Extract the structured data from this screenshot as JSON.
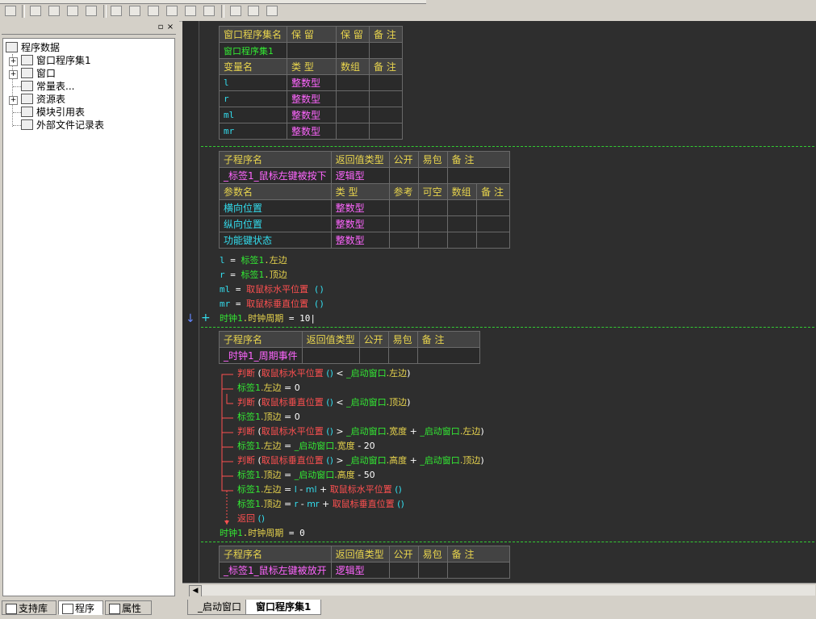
{
  "toolbar": {
    "icons": [
      "grid-icon",
      "align-left-icon",
      "align-center-icon",
      "align-right-icon",
      "align-top-icon",
      "align-middle-icon",
      "align-bottom-icon",
      "space-horizontal-icon",
      "space-vertical-icon",
      "same-width-icon",
      "same-height-icon",
      "same-size-icon"
    ]
  },
  "left_panel": {
    "tree": {
      "root": "程序数据",
      "items": [
        "窗口程序集1",
        "窗口",
        "常量表...",
        "资源表",
        "模块引用表",
        "外部文件记录表"
      ]
    },
    "tabs": [
      "支持库",
      "程序",
      "属性"
    ]
  },
  "editor": {
    "assembly_table": {
      "headers": [
        "窗口程序集名",
        "保 留",
        "保 留",
        "备 注"
      ],
      "row": [
        "窗口程序集1",
        "",
        "",
        ""
      ],
      "var_headers": [
        "变量名",
        "类 型",
        "数组",
        "备 注"
      ],
      "vars": [
        {
          "name": "l",
          "type": "整数型"
        },
        {
          "name": "r",
          "type": "整数型"
        },
        {
          "name": "ml",
          "type": "整数型"
        },
        {
          "name": "mr",
          "type": "整数型"
        }
      ]
    },
    "sub1": {
      "headers": [
        "子程序名",
        "返回值类型",
        "公开",
        "易包",
        "备 注"
      ],
      "row": [
        "_标签1_鼠标左键被按下",
        "逻辑型",
        "",
        "",
        ""
      ],
      "param_headers": [
        "参数名",
        "类 型",
        "参考",
        "可空",
        "数组",
        "备 注"
      ],
      "params": [
        {
          "name": "横向位置",
          "type": "整数型"
        },
        {
          "name": "纵向位置",
          "type": "整数型"
        },
        {
          "name": "功能键状态",
          "type": "整数型"
        }
      ],
      "code": {
        "l1_var": "l",
        "l1_eq": "=",
        "l1_obj": "标签1",
        "l1_prop": ".左边",
        "l2_var": "r",
        "l2_eq": "=",
        "l2_obj": "标签1",
        "l2_prop": ".顶边",
        "l3_var": "ml",
        "l3_eq": "=",
        "l3_fn": "取鼠标水平位置",
        "l3_paren": "()",
        "l4_var": "mr",
        "l4_eq": "=",
        "l4_fn": "取鼠标垂直位置",
        "l4_paren": "()",
        "l5_obj": "时钟1",
        "l5_prop": ".时钟周期",
        "l5_eq": "=",
        "l5_val": "10"
      },
      "gutter_arrow": "↓",
      "gutter_plus": "+"
    },
    "sub2": {
      "headers": [
        "子程序名",
        "返回值类型",
        "公开",
        "易包",
        "备 注"
      ],
      "row": [
        "_时钟1_周期事件",
        "",
        "",
        "",
        ""
      ],
      "lines": [
        {
          "kw": "判断",
          "parts": [
            [
              "(",
              ""
            ],
            [
              "取鼠标水平位置",
              "red"
            ],
            [
              " () ",
              "cyan"
            ],
            [
              "< ",
              "white"
            ],
            [
              "_启动窗口",
              "green"
            ],
            [
              ".左边",
              "yellow"
            ],
            [
              ")",
              "white"
            ]
          ]
        },
        {
          "kw": "",
          "parts": [
            [
              "标签1",
              "green"
            ],
            [
              ".左边",
              "yellow"
            ],
            [
              " = ",
              "white"
            ],
            [
              "0",
              "white"
            ]
          ]
        },
        {
          "kw": "判断",
          "parts": [
            [
              "(",
              ""
            ],
            [
              "取鼠标垂直位置",
              "red"
            ],
            [
              " () ",
              "cyan"
            ],
            [
              "< ",
              "white"
            ],
            [
              "_启动窗口",
              "green"
            ],
            [
              ".顶边",
              "yellow"
            ],
            [
              ")",
              "white"
            ]
          ]
        },
        {
          "kw": "",
          "parts": [
            [
              "标签1",
              "green"
            ],
            [
              ".顶边",
              "yellow"
            ],
            [
              " = ",
              "white"
            ],
            [
              "0",
              "white"
            ]
          ]
        },
        {
          "kw": "判断",
          "parts": [
            [
              "(",
              ""
            ],
            [
              "取鼠标水平位置",
              "red"
            ],
            [
              " () ",
              "cyan"
            ],
            [
              "> ",
              "white"
            ],
            [
              "_启动窗口",
              "green"
            ],
            [
              ".宽度",
              "yellow"
            ],
            [
              " + ",
              "white"
            ],
            [
              "_启动窗口",
              "green"
            ],
            [
              ".左边",
              "yellow"
            ],
            [
              ")",
              "white"
            ]
          ]
        },
        {
          "kw": "",
          "parts": [
            [
              "标签1",
              "green"
            ],
            [
              ".左边",
              "yellow"
            ],
            [
              " = ",
              "white"
            ],
            [
              "_启动窗口",
              "green"
            ],
            [
              ".宽度",
              "yellow"
            ],
            [
              " - ",
              "white"
            ],
            [
              "20",
              "white"
            ]
          ]
        },
        {
          "kw": "判断",
          "parts": [
            [
              "(",
              ""
            ],
            [
              "取鼠标垂直位置",
              "red"
            ],
            [
              " () ",
              "cyan"
            ],
            [
              "> ",
              "white"
            ],
            [
              "_启动窗口",
              "green"
            ],
            [
              ".高度",
              "yellow"
            ],
            [
              " + ",
              "white"
            ],
            [
              "_启动窗口",
              "green"
            ],
            [
              ".顶边",
              "yellow"
            ],
            [
              ")",
              "white"
            ]
          ]
        },
        {
          "kw": "",
          "parts": [
            [
              "标签1",
              "green"
            ],
            [
              ".顶边",
              "yellow"
            ],
            [
              " = ",
              "white"
            ],
            [
              "_启动窗口",
              "green"
            ],
            [
              ".高度",
              "yellow"
            ],
            [
              " - ",
              "white"
            ],
            [
              "50",
              "white"
            ]
          ]
        },
        {
          "kw": "",
          "parts": [
            [
              "标签1",
              "green"
            ],
            [
              ".左边",
              "yellow"
            ],
            [
              " = ",
              "white"
            ],
            [
              "l",
              "cyan"
            ],
            [
              " - ",
              "white"
            ],
            [
              "ml",
              "cyan"
            ],
            [
              " + ",
              "white"
            ],
            [
              "取鼠标水平位置",
              "red"
            ],
            [
              " ()",
              "cyan"
            ]
          ]
        },
        {
          "kw": "",
          "parts": [
            [
              "标签1",
              "green"
            ],
            [
              ".顶边",
              "yellow"
            ],
            [
              " = ",
              "white"
            ],
            [
              "r",
              "cyan"
            ],
            [
              " - ",
              "white"
            ],
            [
              "mr",
              "cyan"
            ],
            [
              " + ",
              "white"
            ],
            [
              "取鼠标垂直位置",
              "red"
            ],
            [
              " ()",
              "cyan"
            ]
          ]
        },
        {
          "kw": "返回",
          "parts": [
            [
              " ()",
              "cyan"
            ]
          ]
        }
      ],
      "last_line": {
        "obj": "时钟1",
        "prop": ".时钟周期",
        "eq": "=",
        "val": "0"
      }
    },
    "sub3": {
      "headers": [
        "子程序名",
        "返回值类型",
        "公开",
        "易包",
        "备 注"
      ],
      "row": [
        "_标签1_鼠标左键被放开",
        "逻辑型",
        "",
        "",
        ""
      ]
    }
  },
  "file_tabs": [
    "_启动窗口",
    "窗口程序集1"
  ],
  "colors": {
    "keyword_red": "#ff5050",
    "object_green": "#33e833",
    "prop_yellow": "#e8d44d",
    "type_pink": "#ff66ff",
    "var_cyan": "#33ddee",
    "bg": "#2e2e2e"
  }
}
